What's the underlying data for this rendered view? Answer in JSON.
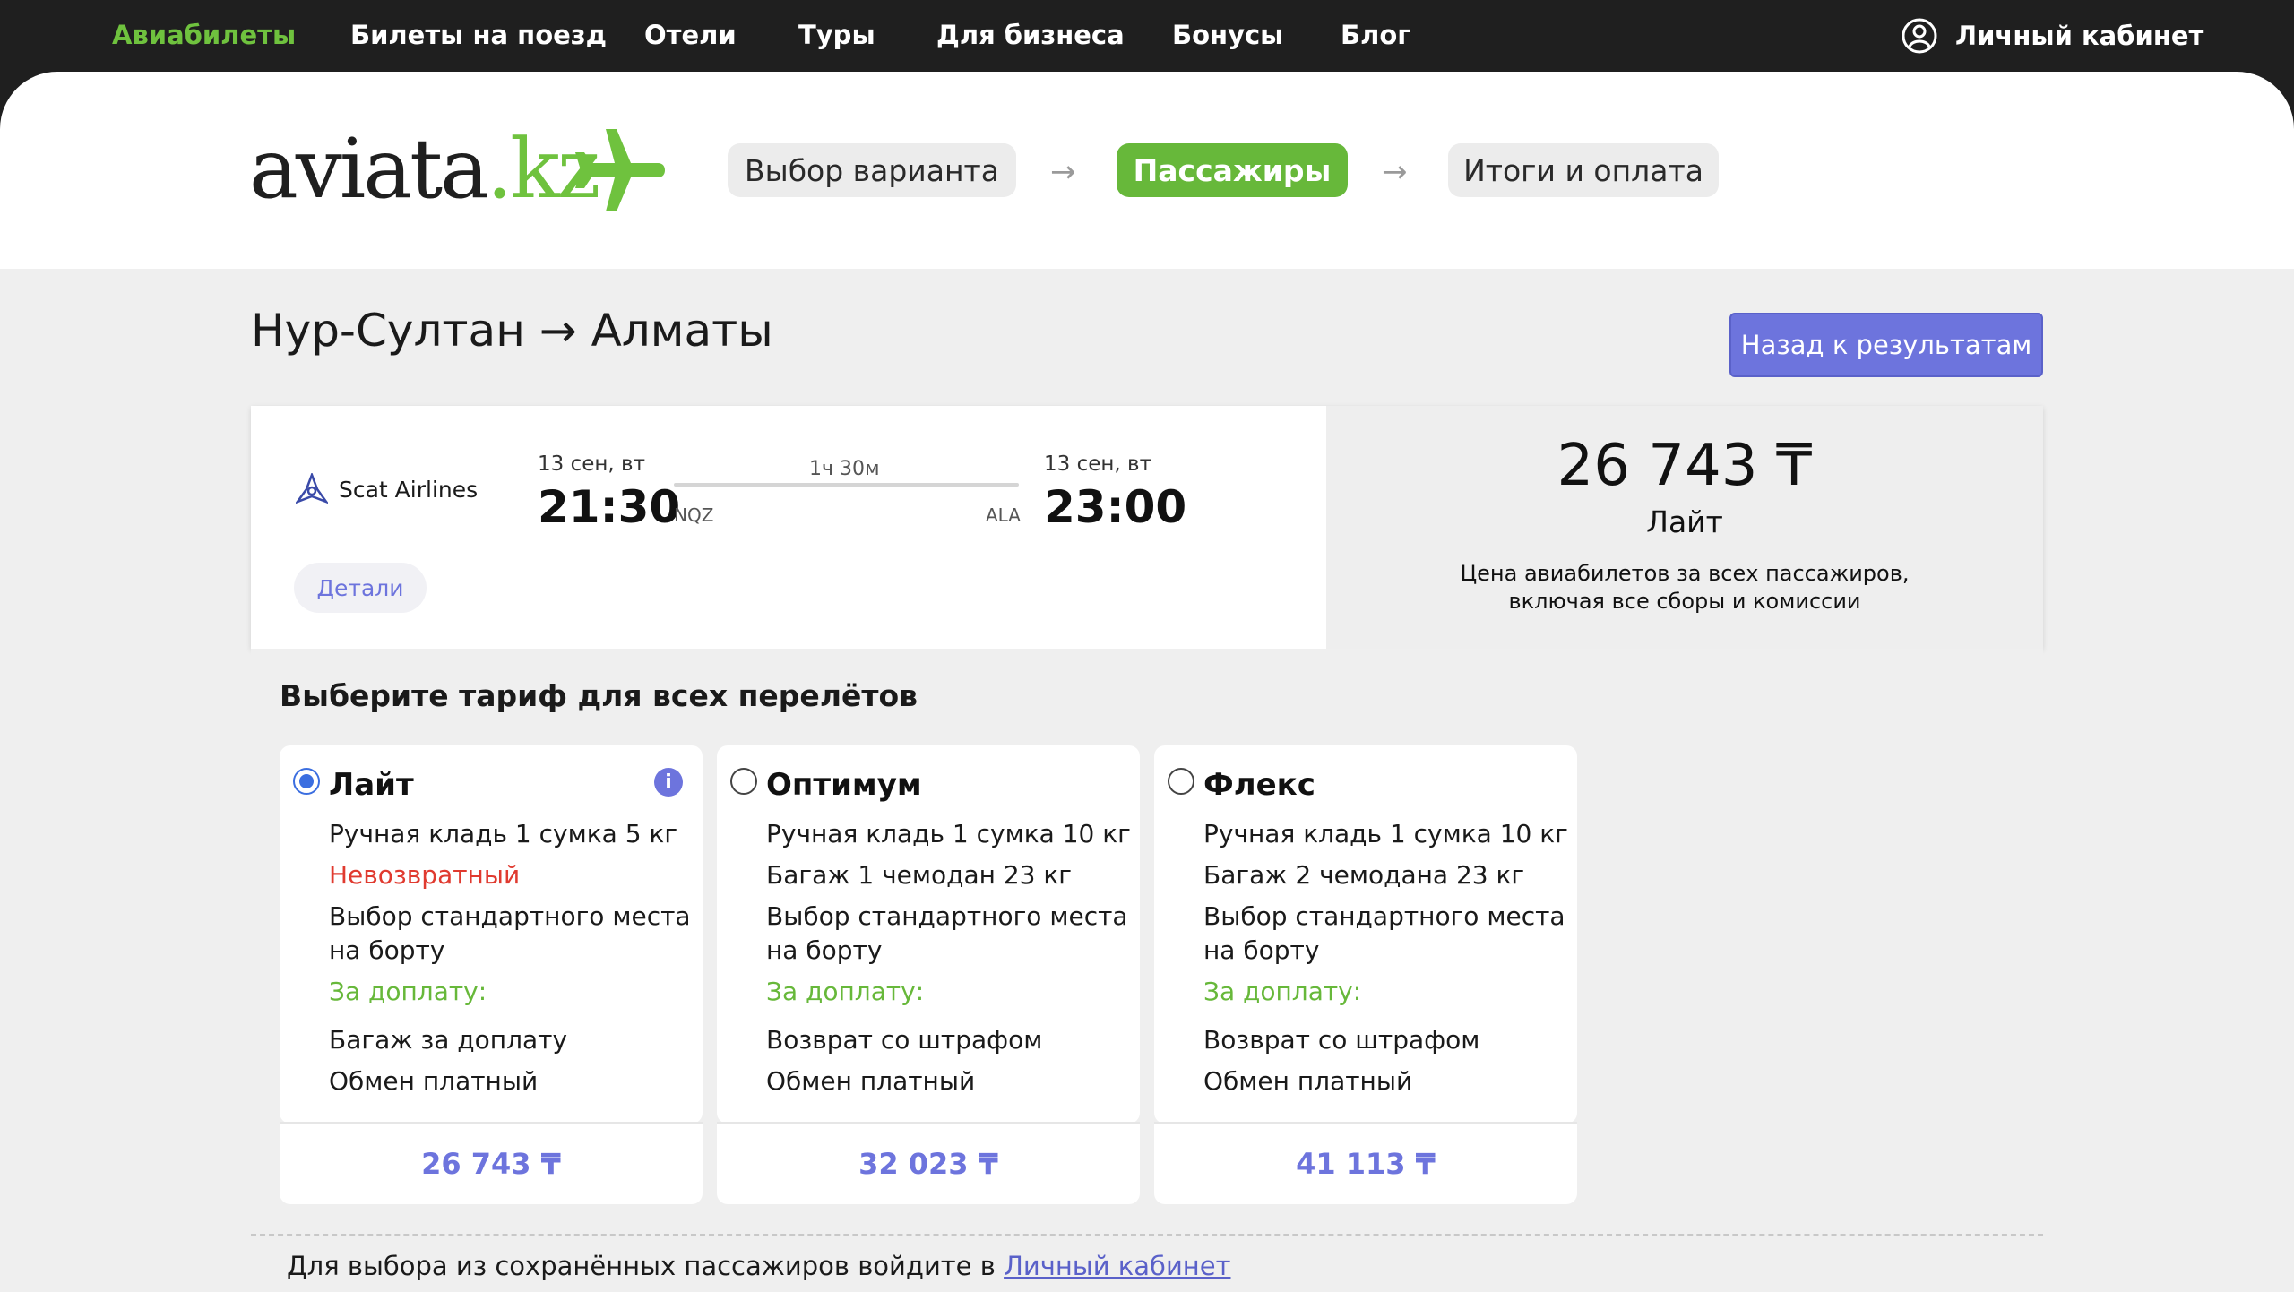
{
  "topnav": {
    "items": [
      {
        "label": "Авиабилеты",
        "active": true
      },
      {
        "label": "Билеты на поезд"
      },
      {
        "label": "Отели"
      },
      {
        "label": "Туры"
      },
      {
        "label": "Для бизнеса"
      },
      {
        "label": "Бонусы"
      },
      {
        "label": "Блог"
      }
    ],
    "account_label": "Личный кабинет"
  },
  "logo": {
    "part1": "aviata",
    "part2": ".kz"
  },
  "steps": [
    {
      "label": "Выбор варианта",
      "state": "inactive"
    },
    {
      "label": "Пассажиры",
      "state": "active"
    },
    {
      "label": "Итоги и оплата",
      "state": "inactive"
    }
  ],
  "step_arrow": "→",
  "route_title": "Нур-Султан → Алматы",
  "back_button": "Назад к результатам",
  "flight": {
    "airline": "Scat Airlines",
    "details": "Детали",
    "dep_date": "13 сен, вт",
    "dep_time": "21:30",
    "dep_iata": "NQZ",
    "duration": "1ч 30м",
    "arr_date": "13 сен, вт",
    "arr_time": "23:00",
    "arr_iata": "ALA",
    "price": "26 743 ₸",
    "tariff": "Лайт",
    "price_note_1": "Цена авиабилетов за всех пассажиров,",
    "price_note_2": "включая все сборы и комиссии"
  },
  "tariffs_heading": "Выберите тариф для всех перелётов",
  "tariffs": [
    {
      "name": "Лайт",
      "selected": true,
      "carry_on": "Ручная кладь 1 сумка 5 кг",
      "second": "Невозвратный",
      "seat_1": "Выбор стандартного места",
      "seat_2": "на борту",
      "extra_label": "За доплату:",
      "extra_1": "Багаж за доплату",
      "extra_2": "Обмен платный",
      "price": "26 743 ₸"
    },
    {
      "name": "Оптимум",
      "selected": false,
      "carry_on": "Ручная кладь 1 сумка 10 кг",
      "second": "Багаж 1 чемодан 23 кг",
      "seat_1": "Выбор стандартного места",
      "seat_2": "на борту",
      "extra_label": "За доплату:",
      "extra_1": "Возврат со штрафом",
      "extra_2": "Обмен платный",
      "price": "32 023 ₸"
    },
    {
      "name": "Флекс",
      "selected": false,
      "carry_on": "Ручная кладь 1 сумка 10 кг",
      "second": "Багаж 2 чемодана 23 кг",
      "seat_1": "Выбор стандартного места",
      "seat_2": "на борту",
      "extra_label": "За доплату:",
      "extra_1": "Возврат со штрафом",
      "extra_2": "Обмен платный",
      "price": "41 113 ₸"
    }
  ],
  "saved_note": {
    "text": "Для выбора из сохранённых пассажиров войдите в ",
    "link": "Личный кабинет"
  },
  "colors": {
    "brand_green": "#6fc23e",
    "accent_blue": "#6d74dd",
    "warning_red": "#e03a2f"
  }
}
